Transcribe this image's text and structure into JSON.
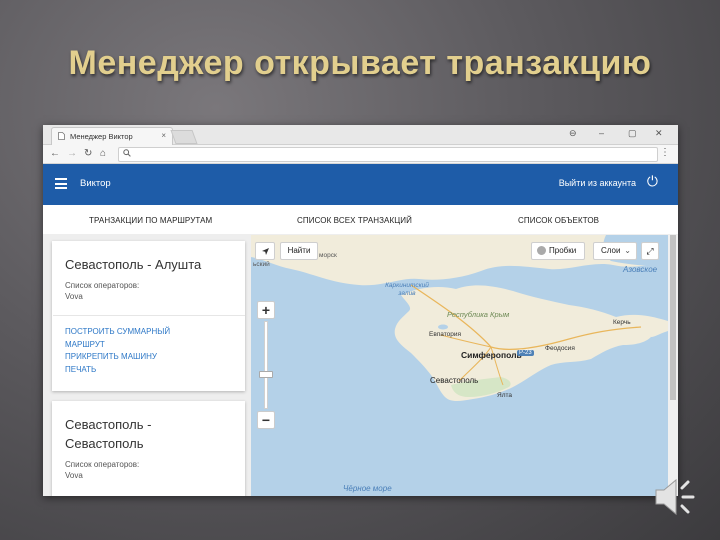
{
  "slide": {
    "title": "Менеджер открывает транзакцию"
  },
  "browser": {
    "tab_title": "Менеджер Виктор",
    "tab_close": "×",
    "min": "–",
    "max": "▢",
    "close": "✕",
    "account": "⊖"
  },
  "header": {
    "user_name": "Виктор",
    "logout_label": "Выйти из аккаунта"
  },
  "tabs": [
    {
      "label": "ТРАНЗАКЦИИ ПО МАРШРУТАМ"
    },
    {
      "label": "СПИСОК ВСЕХ ТРАНЗАКЦИЙ"
    },
    {
      "label": "СПИСОК ОБЪЕКТОВ"
    }
  ],
  "cards": [
    {
      "title": "Севастополь - Алушта",
      "operators_label": "Список операторов:",
      "operator": "Vova",
      "actions": [
        "ПОСТРОИТЬ СУММАРНЫЙ",
        "МАРШРУТ",
        "ПРИКРЕПИТЬ МАШИНУ",
        "ПЕЧАТЬ"
      ]
    },
    {
      "title_line1": "Севастополь -",
      "title_line2": "Севастополь",
      "operators_label": "Список операторов:",
      "operator": "Vova"
    }
  ],
  "map": {
    "find_label": "Найти",
    "traffic_label": "Пробки",
    "layers_label": "Слои",
    "zoom_in": "+",
    "zoom_out": "−",
    "labels": {
      "black_sea": "Чёрное море",
      "azov": "Азовское",
      "simferopol": "Симферополь",
      "sevastopol": "Севастополь",
      "evpatoria": "Евпатория",
      "yalta": "Ялта",
      "feodosia": "Феодосия",
      "kerch": "Керчь",
      "republic": "Республика Крым",
      "karkinit": "Каркинитский залив",
      "sea_frag": "морск",
      "west_frag": "ьский",
      "road": "Р-23"
    }
  }
}
